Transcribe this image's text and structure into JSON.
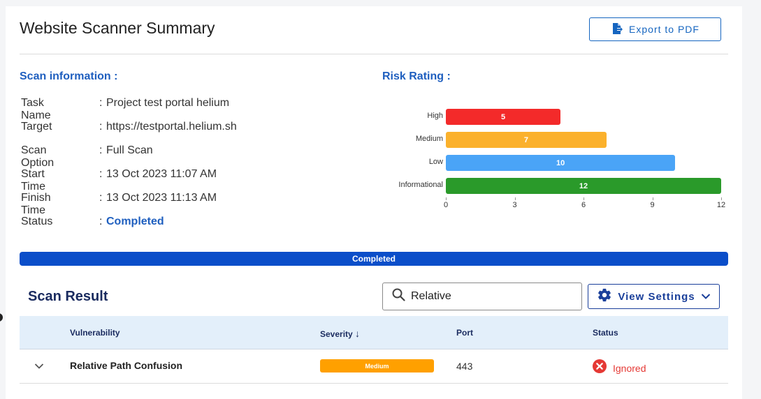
{
  "header": {
    "title": "Website Scanner Summary",
    "export_label": "Export to PDF"
  },
  "scan_info": {
    "heading": "Scan information :",
    "rows": [
      {
        "label": "Task Name",
        "value": "Project test portal helium"
      },
      {
        "label": "Target",
        "value": "https://testportal.helium.sh"
      },
      {
        "label": "Scan Option",
        "value": "Full Scan"
      },
      {
        "label": "Start Time",
        "value": "13 Oct 2023 11:07 AM"
      },
      {
        "label": "Finish Time",
        "value": "13 Oct 2023 11:13 AM"
      },
      {
        "label": "Status",
        "value": "Completed"
      }
    ]
  },
  "risk_rating": {
    "heading": "Risk Rating :"
  },
  "chart_data": {
    "type": "bar",
    "orientation": "horizontal",
    "categories": [
      "High",
      "Medium",
      "Low",
      "Informational"
    ],
    "values": [
      5,
      7,
      10,
      12
    ],
    "colors": [
      "#f32a2a",
      "#fbb12c",
      "#4aa4f7",
      "#2a9a2a"
    ],
    "xlim": [
      0,
      12
    ],
    "xticks": [
      0,
      3,
      6,
      9,
      12
    ],
    "grid": false
  },
  "progress": {
    "label": "Completed",
    "value_fraction": 1.0,
    "color": "#0b4ec9"
  },
  "scan_result": {
    "title": "Scan Result",
    "search_value": "Relative",
    "view_settings_label": "View Settings",
    "columns": [
      "Vulnerability",
      "Severity",
      "Port",
      "Status"
    ],
    "sort_indicator": "↓",
    "rows": [
      {
        "vulnerability": "Relative Path Confusion",
        "severity": "Medium",
        "port": "443",
        "status": "Ignored"
      }
    ]
  },
  "colors": {
    "accent": "#1f5fbf",
    "severity_medium": "#ffa000",
    "status_ignored": "#e53935",
    "table_header_bg": "#e3effa"
  },
  "icons": {
    "export": "file-export-icon",
    "search": "search-icon",
    "settings": "gear-icon",
    "dropdown": "chevron-down-icon",
    "expand": "chevron-down-icon",
    "ignored": "error-circle-icon"
  }
}
